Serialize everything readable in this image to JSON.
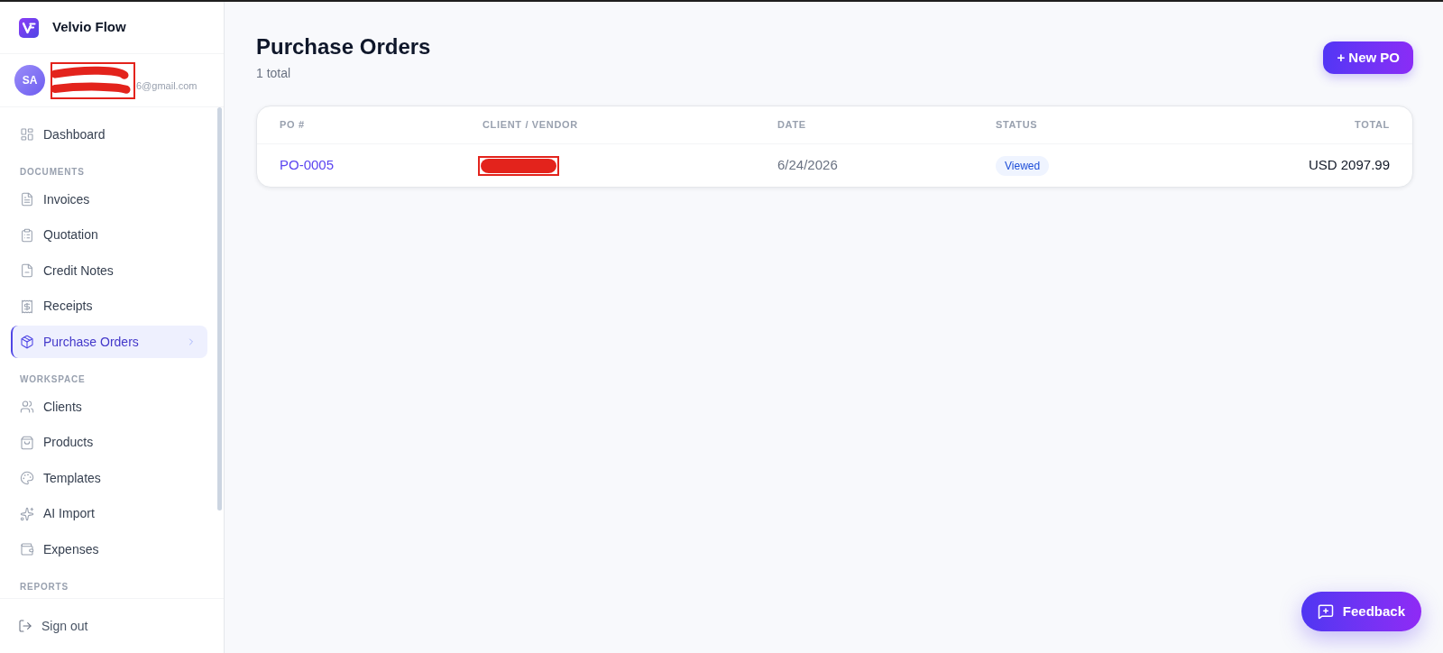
{
  "app": {
    "name": "Velvio Flow"
  },
  "user": {
    "initials": "SA",
    "email": "6@gmail.com",
    "redacted": true
  },
  "sidebar": {
    "items": [
      {
        "kind": "item",
        "label": "Dashboard",
        "selected": false
      },
      {
        "kind": "section",
        "label": "DOCUMENTS"
      },
      {
        "kind": "item",
        "label": "Invoices",
        "selected": false
      },
      {
        "kind": "item",
        "label": "Quotation",
        "selected": false
      },
      {
        "kind": "item",
        "label": "Credit Notes",
        "selected": false
      },
      {
        "kind": "item",
        "label": "Receipts",
        "selected": false
      },
      {
        "kind": "item",
        "label": "Purchase Orders",
        "selected": true
      },
      {
        "kind": "section",
        "label": "WORKSPACE"
      },
      {
        "kind": "item",
        "label": "Clients",
        "selected": false
      },
      {
        "kind": "item",
        "label": "Products",
        "selected": false
      },
      {
        "kind": "item",
        "label": "Templates",
        "selected": false
      },
      {
        "kind": "item",
        "label": "AI Import",
        "selected": false
      },
      {
        "kind": "item",
        "label": "Expenses",
        "selected": false
      },
      {
        "kind": "section",
        "label": "REPORTS"
      }
    ],
    "sign_out": "Sign out"
  },
  "page": {
    "title": "Purchase Orders",
    "subtitle": "1 total",
    "new_button": "+ New PO"
  },
  "table": {
    "columns": [
      "PO #",
      "CLIENT / VENDOR",
      "DATE",
      "STATUS",
      "TOTAL"
    ],
    "rows": [
      {
        "po": "PO-0005",
        "client_redacted": true,
        "date": "6/24/2026",
        "status": "Viewed",
        "total": "USD 2097.99"
      }
    ]
  },
  "feedback_button": {
    "label": "Feedback"
  }
}
